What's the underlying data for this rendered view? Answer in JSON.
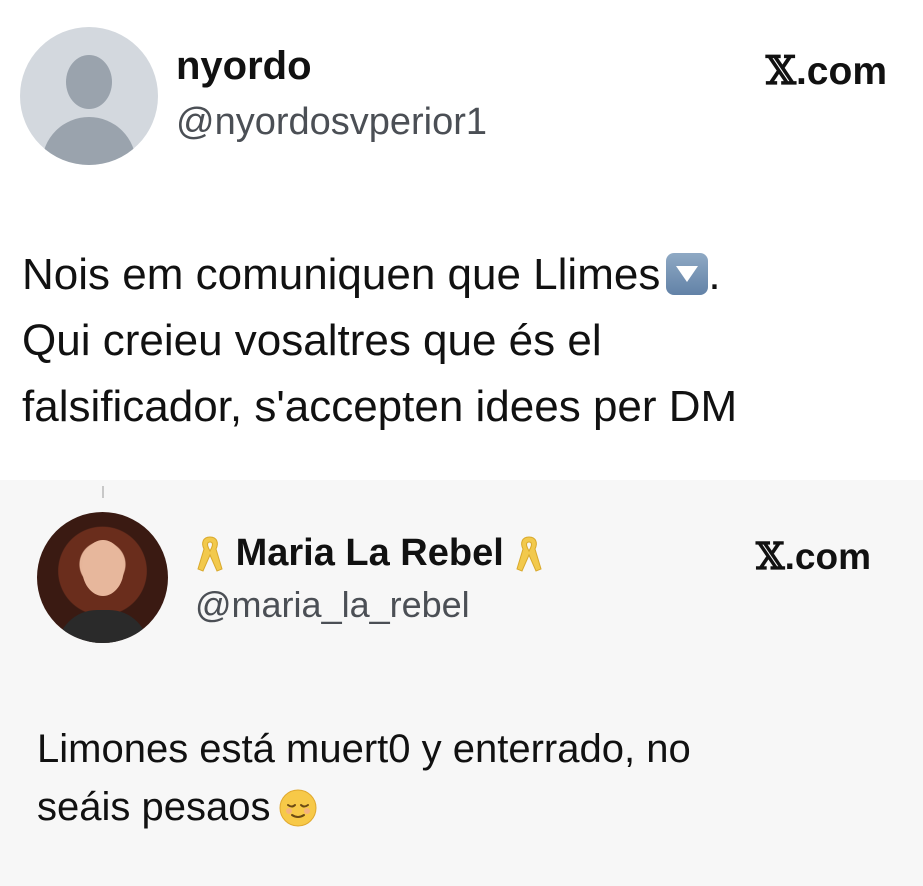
{
  "tweet": {
    "author_name": "nyordo",
    "author_handle": "@nyordosvperior1",
    "source_prefix": "𝕏",
    "source_suffix": ".com",
    "text_lines": [
      "Nois em comuniquen que Llimes",
      "Qui creieu vosaltres que és el",
      "falsificador, s'accepten idees per DM"
    ],
    "line1_tail": ".",
    "emoji_1": "down-arrow-button-emoji"
  },
  "quoted_tweet": {
    "author_name": "Maria La Rebel",
    "author_handle": "@maria_la_rebel",
    "source_prefix": "𝕏",
    "source_suffix": ".com",
    "name_decoration": "yellow-ribbon-emoji",
    "text_lines": [
      "Limones está muert0 y enterrado, no",
      "seáis pesaos"
    ],
    "emoji_2": "relieved-face-emoji"
  },
  "colors": {
    "background": "#ffffff",
    "quote_background": "#f7f7f7",
    "text": "#111111",
    "handle": "#4b4f55",
    "ribbon": "#f2c94c"
  }
}
